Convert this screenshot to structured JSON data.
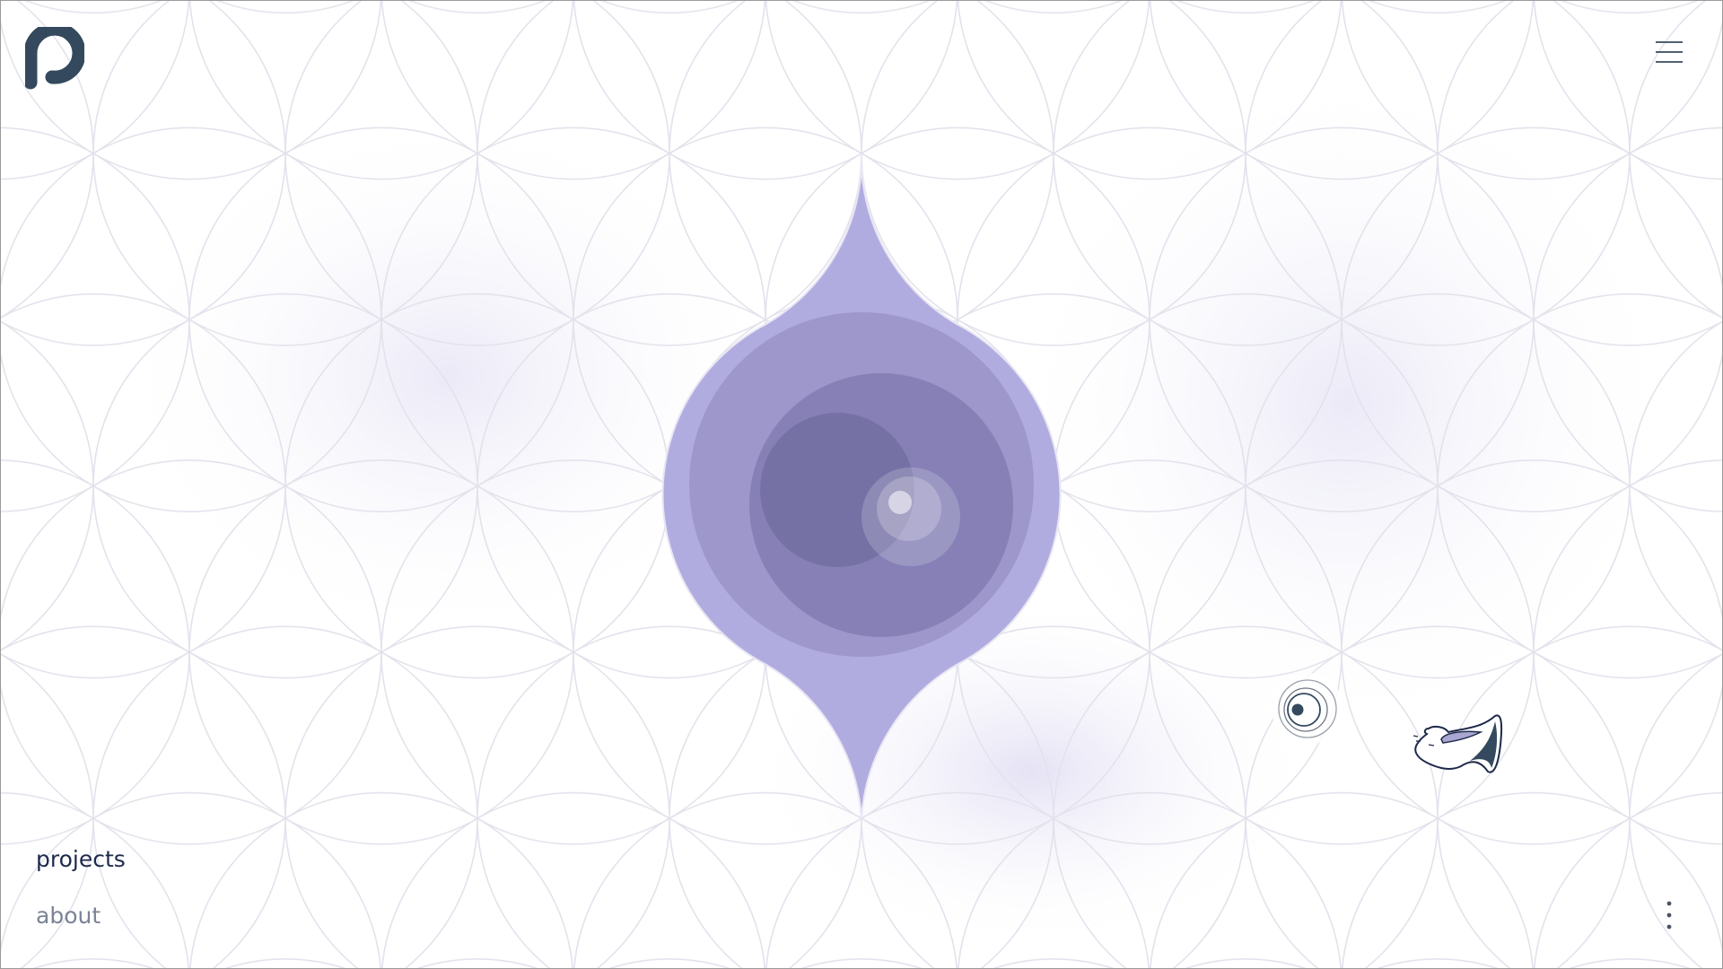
{
  "brand": {
    "logo_icon": "p-logo-icon",
    "logo_color": "#34495e"
  },
  "header": {
    "menu_icon": "hamburger-menu-icon"
  },
  "nav": {
    "items": [
      {
        "label": "projects",
        "active": true
      },
      {
        "label": "about",
        "active": false
      }
    ]
  },
  "footer": {
    "more_icon": "vertical-dots-icon"
  },
  "hero": {
    "shape": "teardrop-orb",
    "colors": {
      "outer": "#b1ace0",
      "ring": "#9d97cc",
      "inner": "#8680b6",
      "core": "#7571a5"
    }
  },
  "widgets": {
    "target_icon": "target-icon",
    "shoe_icon": "shoe-icon"
  },
  "background": {
    "pattern": "flower-of-life",
    "stroke": "#e6e5ee"
  }
}
